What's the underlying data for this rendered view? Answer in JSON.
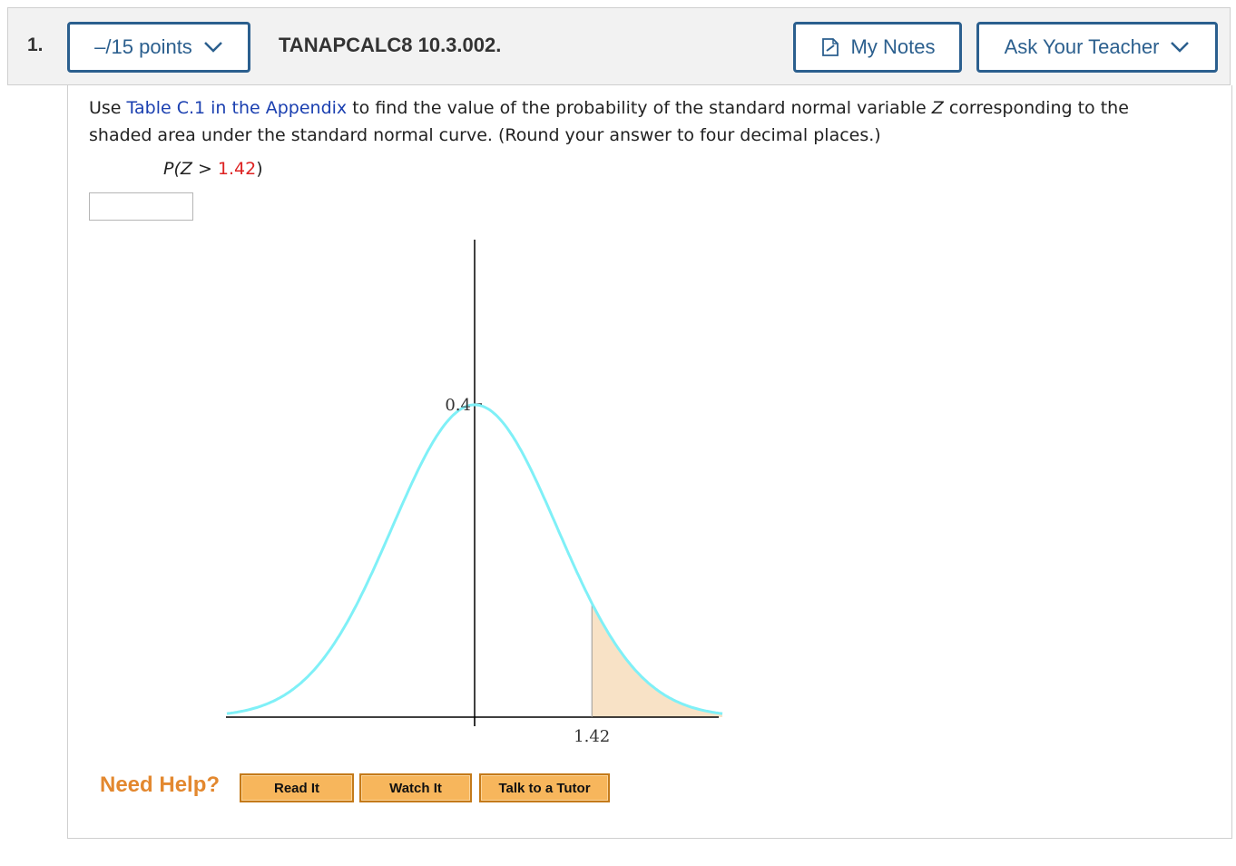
{
  "header": {
    "question_number": "1.",
    "points_label": "–/15 points",
    "question_code": "TANAPCALC8 10.3.002.",
    "notes_label": "My Notes",
    "teacher_label": "Ask Your Teacher"
  },
  "question": {
    "text_before_link": "Use ",
    "link_text": "Table C.1 in the Appendix",
    "text_after_link_1": " to find the value of the probability of the standard normal variable ",
    "variable": "Z",
    "text_after_link_2": " corresponding to the shaded area under the standard normal curve. (Round your answer to four decimal places.)",
    "prob_prefix": "P(",
    "prob_var": "Z",
    "prob_op": " > ",
    "prob_value": "1.42",
    "prob_suffix": ")",
    "answer_value": ""
  },
  "chart_data": {
    "type": "area",
    "function": "standard normal density",
    "x_range": [
      -3,
      3
    ],
    "y_tick_labels": [
      "0.4"
    ],
    "x_tick_labels": [
      "1.42"
    ],
    "shade_from": 1.42,
    "curve_color": "#7ff0f7",
    "shade_color": "#f8e2c6"
  },
  "help": {
    "label": "Need Help?",
    "read": "Read It",
    "watch": "Watch It",
    "tutor": "Talk to a Tutor"
  },
  "colors": {
    "accent": "#2b5f8e",
    "link": "#1a3fb0",
    "value_red": "#dd2222",
    "help_orange": "#e3882f"
  }
}
